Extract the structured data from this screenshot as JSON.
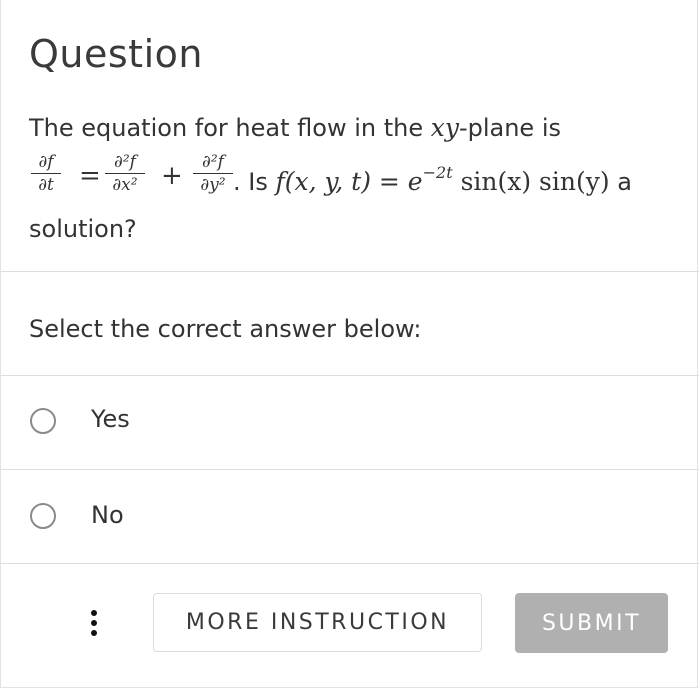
{
  "question": {
    "title": "Question",
    "line1_text": "The equation for heat flow in the ",
    "line1_math": "xy",
    "line1_suffix": "-plane is",
    "pde": {
      "lhs_num": "∂f",
      "lhs_den": "∂t",
      "equals": "=",
      "term1_num": "∂²f",
      "term1_den": "∂x²",
      "plus": "+",
      "term2_num": "∂²f",
      "term2_den": "∂y²",
      "after": ". Is ",
      "function": "f(x, y, t) = e",
      "exponent": "−2t",
      "function_rest": " sin(x) sin(y)",
      "trailing": " a"
    },
    "line3_text": "solution?"
  },
  "answer": {
    "prompt": "Select the correct answer below:",
    "options": [
      {
        "label": "Yes",
        "selected": false
      },
      {
        "label": "No",
        "selected": false
      }
    ]
  },
  "footer": {
    "more_menu_icon": "vertical-ellipsis",
    "more_instruction_label": "MORE INSTRUCTION",
    "submit_label": "SUBMIT",
    "submit_color": "#b0b0b0"
  }
}
